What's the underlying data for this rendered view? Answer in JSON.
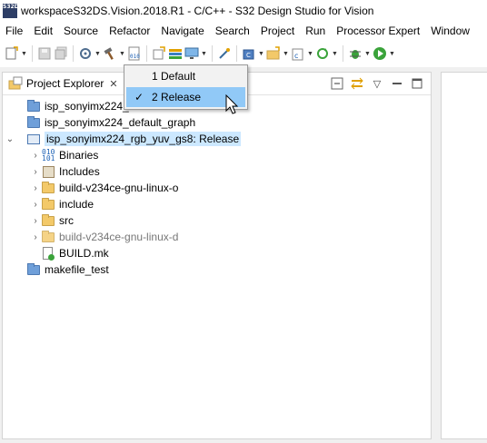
{
  "window": {
    "title": "workspaceS32DS.Vision.2018.R1 - C/C++ - S32 Design Studio for Vision",
    "app_icon_text": "S32DS"
  },
  "menubar": [
    "File",
    "Edit",
    "Source",
    "Refactor",
    "Navigate",
    "Search",
    "Project",
    "Run",
    "Processor Expert",
    "Window"
  ],
  "toolbar": {
    "icons": [
      "new-icon",
      "save-icon",
      "save-all-icon",
      "settings-icon",
      "build-hammer-icon",
      "binary-icon",
      "new-class-icon",
      "stack-icon",
      "monitor-icon",
      "pin-icon",
      "new-project-icon",
      "folder-new-icon",
      "new-c-file-icon",
      "refresh-run-icon",
      "debug-icon",
      "run-icon"
    ]
  },
  "explorer": {
    "tab_label": "Project Explorer",
    "tree": [
      {
        "label": "isp_sonyimx224_",
        "type": "project",
        "depth": 0,
        "twisty": ""
      },
      {
        "label": "isp_sonyimx224_default_graph",
        "type": "project",
        "depth": 0,
        "twisty": ""
      },
      {
        "label": "isp_sonyimx224_rgb_yuv_gs8: Release",
        "type": "project-open",
        "depth": 0,
        "twisty": "v",
        "selected": true
      },
      {
        "label": "Binaries",
        "type": "binaries",
        "depth": 1,
        "twisty": ">"
      },
      {
        "label": "Includes",
        "type": "includes",
        "depth": 1,
        "twisty": ">"
      },
      {
        "label": "build-v234ce-gnu-linux-o",
        "type": "folder",
        "depth": 1,
        "twisty": ">"
      },
      {
        "label": "include",
        "type": "folder",
        "depth": 1,
        "twisty": ">"
      },
      {
        "label": "src",
        "type": "folder",
        "depth": 1,
        "twisty": ">"
      },
      {
        "label": "build-v234ce-gnu-linux-d",
        "type": "folder",
        "depth": 1,
        "twisty": ">",
        "muted": true
      },
      {
        "label": "BUILD.mk",
        "type": "file",
        "depth": 1,
        "twisty": ""
      },
      {
        "label": "makefile_test",
        "type": "project",
        "depth": 0,
        "twisty": ""
      }
    ]
  },
  "build_config_menu": {
    "items": [
      {
        "label": "1 Default",
        "checked": false
      },
      {
        "label": "2 Release",
        "checked": true
      }
    ]
  },
  "colors": {
    "selection": "#cce8ff",
    "menu_hover": "#91c9f7",
    "folder": "#f3c969",
    "project": "#6f9fd9"
  }
}
